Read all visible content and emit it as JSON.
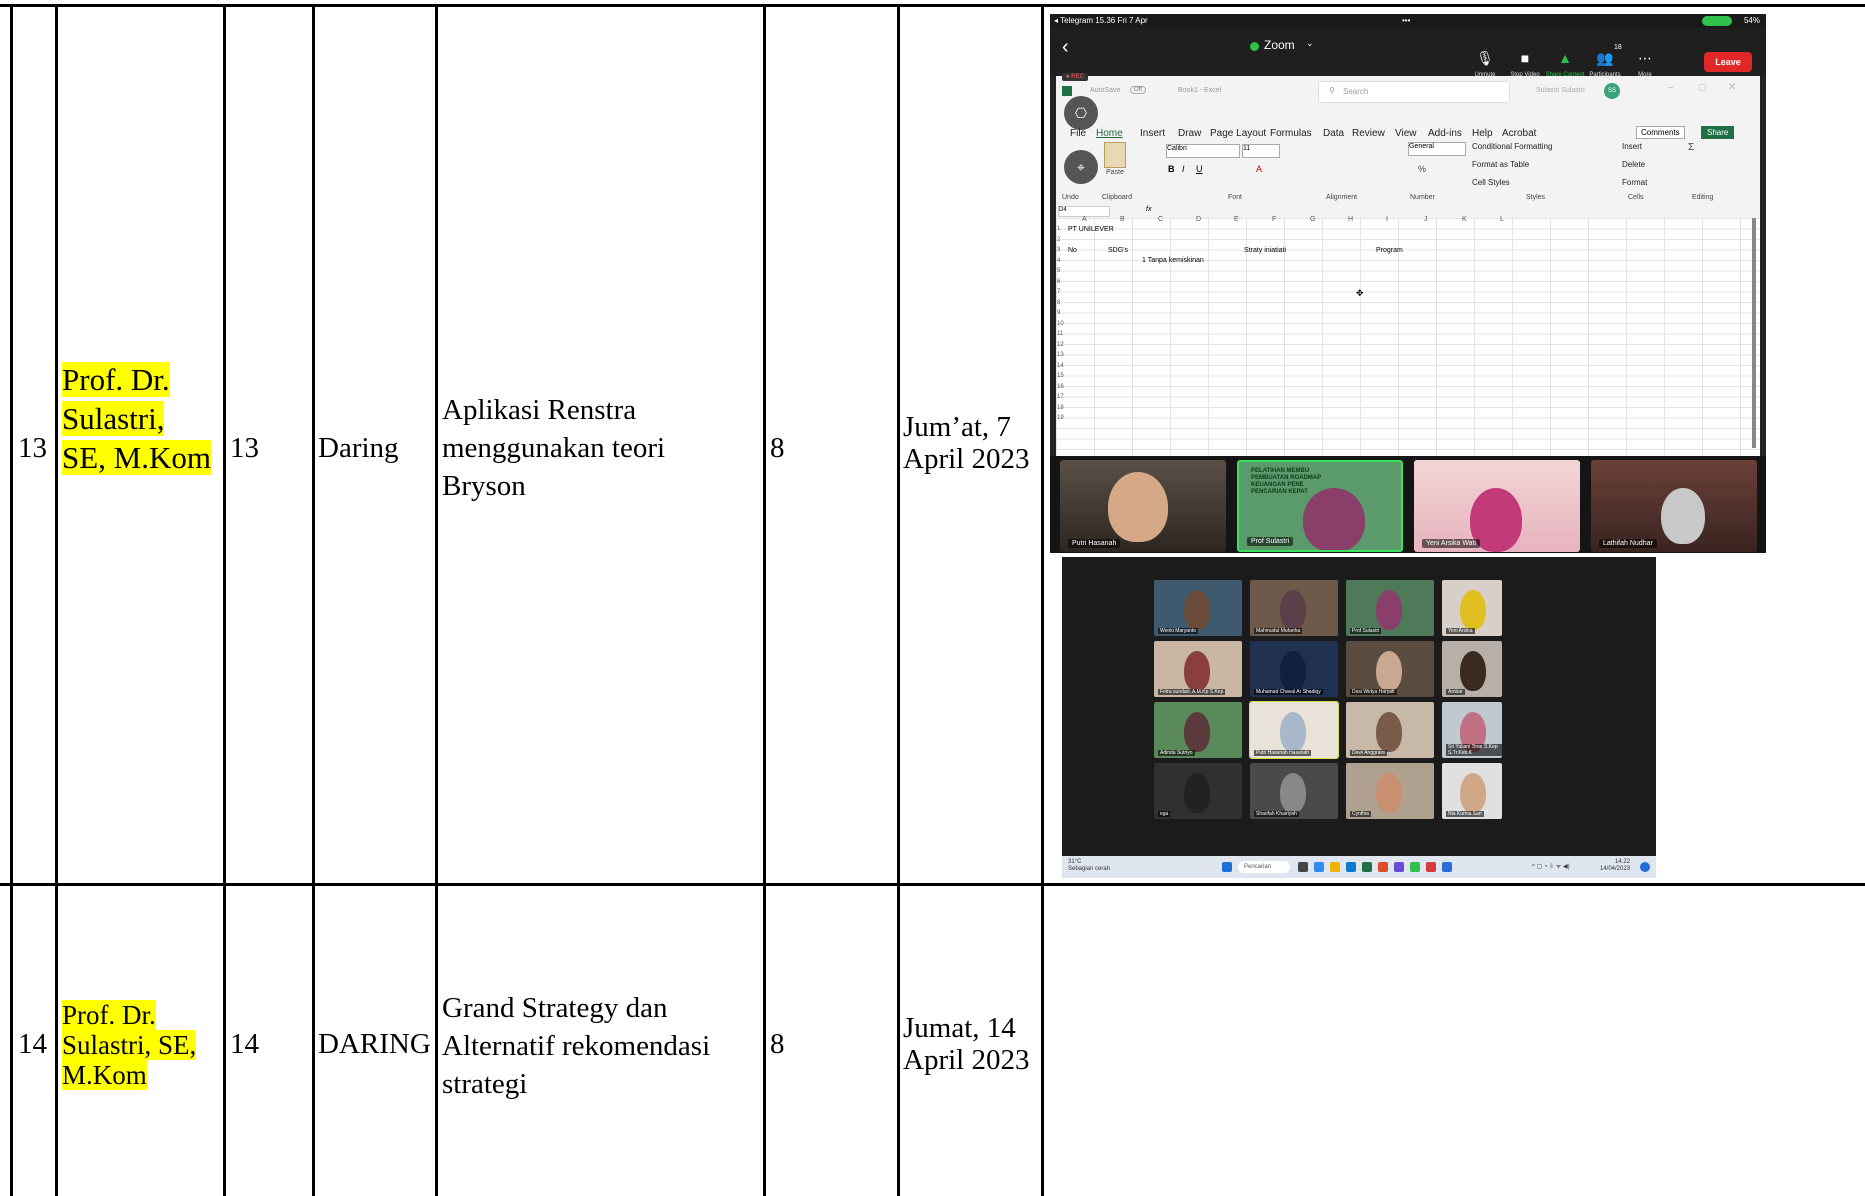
{
  "rows": [
    {
      "no": "13",
      "lecturer": [
        "Prof. Dr.",
        "Sulastri,",
        "SE, M.Kom"
      ],
      "meeting": "13",
      "mode": "Daring",
      "topic": [
        "Aplikasi Renstra",
        "menggunakan teori",
        "Bryson"
      ],
      "value": "8",
      "date": [
        "Jum’at, 7",
        "April 2023"
      ]
    },
    {
      "no": "14",
      "lecturer": [
        "Prof. Dr.",
        "Sulastri, SE,",
        "M.Kom"
      ],
      "meeting": "14",
      "mode": "DARING",
      "topic": [
        "Grand Strategy dan",
        "Alternatif rekomendasi",
        "strategi"
      ],
      "value": "8",
      "date": [
        "Jumat, 14",
        "April 2023"
      ]
    }
  ],
  "highlight_color": "#ffff00",
  "zoom_screenshot": {
    "status_left": "◂ Telegram  15.36  Fri 7 Apr",
    "status_right": "54%",
    "title": "Zoom",
    "controls": [
      "Unmute",
      "Stop Video",
      "Share Content",
      "Participants",
      "More"
    ],
    "participants_count": "18",
    "leave": "Leave",
    "rec": "● REC",
    "excel": {
      "autosave": "AutoSave",
      "autosave_state": "Off",
      "book": "Book1 - Excel",
      "search": "Search",
      "user": "Sulastri Sulastri",
      "user_initials": "SS",
      "tabs": [
        "File",
        "Home",
        "Insert",
        "Draw",
        "Page Layout",
        "Formulas",
        "Data",
        "Review",
        "View",
        "Add-ins",
        "Help",
        "Acrobat"
      ],
      "active_tab": "Home",
      "comments": "Comments",
      "share": "Share",
      "font_name": "Calibri",
      "font_size": "11",
      "number_format": "General",
      "styles": [
        "Conditional Formatting",
        "Format as Table",
        "Cell Styles"
      ],
      "cells": [
        "Insert",
        "Delete",
        "Format"
      ],
      "groups": [
        "Undo",
        "Clipboard",
        "Font",
        "Alignment",
        "Number",
        "Styles",
        "Cells",
        "Editing"
      ],
      "paste": "Paste",
      "name_box": "D4",
      "columns": [
        "A",
        "B",
        "C",
        "D",
        "E",
        "F",
        "G",
        "H",
        "I",
        "J",
        "K",
        "L"
      ],
      "a1": "PT UNILEVER",
      "row3": [
        "No",
        "SDG's",
        "Straty iniatiati",
        "Program"
      ],
      "row4": "1 Tanpa kemiskinan",
      "row_numbers": [
        "1",
        "2",
        "3",
        "4",
        "5",
        "6",
        "7",
        "8",
        "9",
        "10",
        "11",
        "12",
        "13",
        "14",
        "15",
        "16",
        "17",
        "18",
        "19"
      ]
    },
    "participants": [
      "Putri Hasanah",
      "Prof Sulastri",
      "Yeni Arsika Wati",
      "Lathifah Nudhar"
    ],
    "banner_text": [
      "PELATIHAN MEMBU",
      "PEMBUATAN ROADMAP",
      "KEUANGAN PENE",
      "PENCARIAN KEPAT"
    ]
  },
  "zoom_gallery": {
    "names": [
      "Wenki Maryanto",
      "Mahmudul Mufariha",
      "Prof Sulastri",
      "Yeni Arsika",
      "Fetra sundari, A.M.Kp S.Kep",
      "Muhamad Chaval Ar Shadiqy",
      "Desi Widya Haryati",
      "Ambar",
      "Adinda Sutriyo",
      "Putri Hasanah Hasanah",
      "Dewi Anggraini",
      "Sri Yuliani Tinar S.Kep S.Tr.Keb.K",
      "ega",
      "Sharifah Khairiyah",
      "Cynthia",
      "Nia Kurnia Sari"
    ],
    "weather": [
      "31°C",
      "Sebagian cerah"
    ],
    "search": "Pencarian",
    "clock": [
      "14.22",
      "14/04/2023"
    ]
  }
}
